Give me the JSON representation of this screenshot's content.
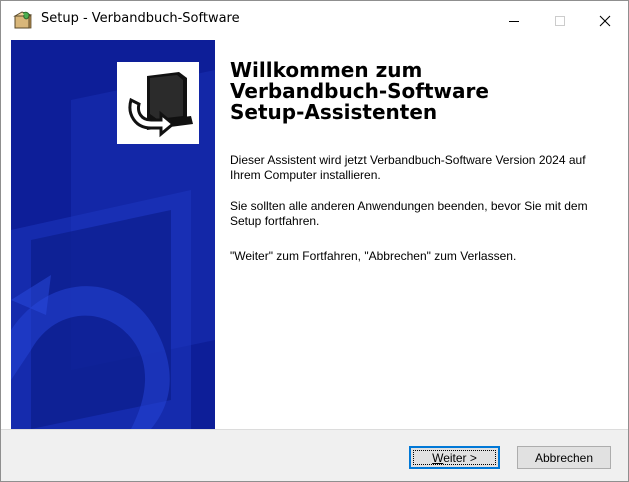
{
  "window": {
    "title": "Setup - Verbandbuch-Software",
    "icon": "setup-package-icon"
  },
  "titlebar_buttons": {
    "minimize": "minimize-icon",
    "maximize": "maximize-icon",
    "close": "close-icon"
  },
  "wizard": {
    "heading_lines": [
      "Willkommen zum",
      "Verbandbuch-Software",
      "Setup-Assistenten"
    ],
    "paragraph1": "Dieser Assistent wird jetzt Verbandbuch-Software Version 2024 auf Ihrem Computer installieren.",
    "paragraph2": "Sie sollten alle anderen Anwendungen beenden, bevor Sie mit dem Setup fortfahren.",
    "paragraph3": "\"Weiter\" zum Fortfahren, \"Abbrechen\" zum Verlassen."
  },
  "buttons": {
    "next_mnemonic": "W",
    "next_rest": "eiter >",
    "cancel": "Abbrechen"
  },
  "colors": {
    "side_panel": "#0d1e98",
    "footer": "#f0f0f0",
    "focus_border": "#0078d7"
  }
}
